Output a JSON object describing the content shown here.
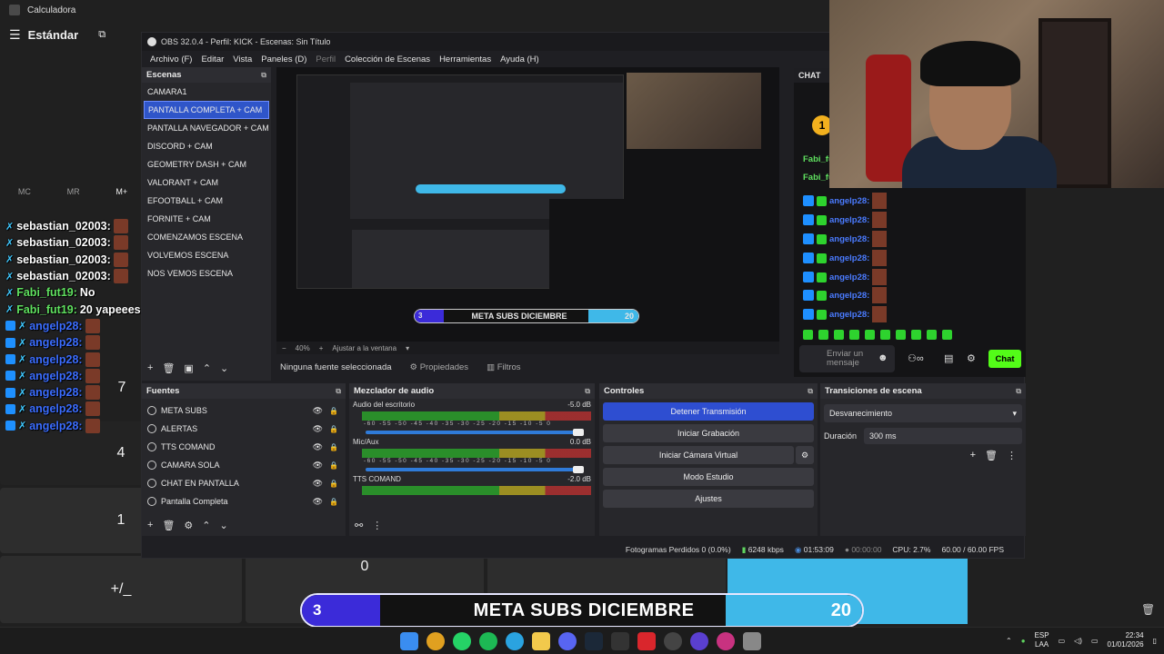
{
  "calculator": {
    "window_title": "Calculadora",
    "mode": "Estándar",
    "memory_buttons": [
      "MC",
      "MR",
      "M+"
    ],
    "keys": [
      "7",
      "4",
      "1",
      "+/_",
      "0"
    ]
  },
  "left_chat": [
    {
      "name": "sebastian_02003:",
      "style": "white",
      "msg": "",
      "emote": true
    },
    {
      "name": "sebastian_02003:",
      "style": "white",
      "msg": "",
      "emote": true
    },
    {
      "name": "sebastian_02003:",
      "style": "white",
      "msg": "",
      "emote": true
    },
    {
      "name": "sebastian_02003:",
      "style": "white",
      "msg": "",
      "emote": true
    },
    {
      "name": "Fabi_fut19:",
      "style": "green",
      "msg": "No",
      "emote": false
    },
    {
      "name": "Fabi_fut19:",
      "style": "green",
      "msg": "20 yapeees",
      "emote": false
    },
    {
      "name": "angelp28:",
      "style": "blue",
      "msg": "",
      "emote": true
    },
    {
      "name": "angelp28:",
      "style": "blue",
      "msg": "",
      "emote": true
    },
    {
      "name": "angelp28:",
      "style": "blue",
      "msg": "",
      "emote": true
    },
    {
      "name": "angelp28:",
      "style": "blue",
      "msg": "",
      "emote": true
    },
    {
      "name": "angelp28:",
      "style": "blue",
      "msg": "",
      "emote": true
    },
    {
      "name": "angelp28:",
      "style": "blue",
      "msg": "",
      "emote": true
    },
    {
      "name": "angelp28:",
      "style": "blue",
      "msg": "",
      "emote": true
    }
  ],
  "obs": {
    "title": "OBS 32.0.4 - Perfil: KICK - Escenas: Sin Título",
    "menu": [
      "Archivo (F)",
      "Editar",
      "Vista",
      "Paneles (D)",
      "Perfil",
      "Colección de Escenas",
      "Herramientas",
      "Ayuda (H)"
    ],
    "scenes_header": "Escenas",
    "scenes": [
      "CAMARA1",
      "PANTALLA COMPLETA + CAM",
      "PANTALLA NAVEGADOR + CAM",
      "DISCORD + CAM",
      "GEOMETRY DASH + CAM",
      "VALORANT + CAM",
      "EFOOTBALL + CAM",
      "FORNITE + CAM",
      "COMENZAMOS ESCENA",
      "VOLVEMOS ESCENA",
      "NOS VEMOS ESCENA"
    ],
    "selected_scene": 1,
    "zoom": "40%",
    "fit_label": "Ajustar a la ventana",
    "no_source": "Ninguna fuente seleccionada",
    "properties": "Propiedades",
    "filters": "Filtros",
    "sources_header": "Fuentes",
    "sources": [
      "META SUBS",
      "ALERTAS",
      "TTS COMAND",
      "CAMARA SOLA",
      "CHAT EN PANTALLA",
      "Pantalla Completa"
    ],
    "mixer_header": "Mezclador de audio",
    "mixer": [
      {
        "name": "Audio del escritorio",
        "db": "-5.0 dB"
      },
      {
        "name": "Mic/Aux",
        "db": "0.0 dB"
      },
      {
        "name": "TTS COMAND",
        "db": "-2.0 dB"
      }
    ],
    "meter_scale": "-60 -55 -50 -45 -40 -35 -30 -25 -20 -15 -10 -5 0",
    "controls_header": "Controles",
    "controls": [
      "Detener Transmisión",
      "Iniciar Grabación",
      "Iniciar Cámara Virtual",
      "Modo Estudio",
      "Ajustes"
    ],
    "transitions_header": "Transiciones de escena",
    "transition": "Desvanecimiento",
    "duration_label": "Duración",
    "duration": "300 ms",
    "status": {
      "dropped": "Fotogramas Perdidos 0 (0.0%)",
      "bitrate": "6248 kbps",
      "live_time": "01:53:09",
      "rec_time": "00:00:00",
      "cpu": "CPU: 2.7%",
      "fps": "60.00 / 60.00 FPS"
    },
    "chat_header": "CHAT",
    "chat_rows": [
      "Fabi_fu",
      "Fabi_fu",
      "angelp28:",
      "angelp28:",
      "angelp28:",
      "angelp28:",
      "angelp28:",
      "angelp28:",
      "angelp28:"
    ],
    "chat_input_placeholder": "Enviar un mensaje",
    "chat_send": "Chat"
  },
  "goal": {
    "current": "3",
    "title": "META SUBS DICIEMBRE",
    "target": "20"
  },
  "preview_goal": {
    "current": "3",
    "title": "META SUBS DICIEMBRE",
    "target": "20"
  },
  "taskbar": {
    "lang_top": "ESP",
    "lang_bottom": "LAA",
    "time": "22:34",
    "date": "01/01/2026"
  },
  "colors": {
    "obs_selected": "#2f55c9",
    "goal_left": "#3b2bd9",
    "goal_right": "#3fb8e8",
    "kick_green": "#53fc18"
  }
}
